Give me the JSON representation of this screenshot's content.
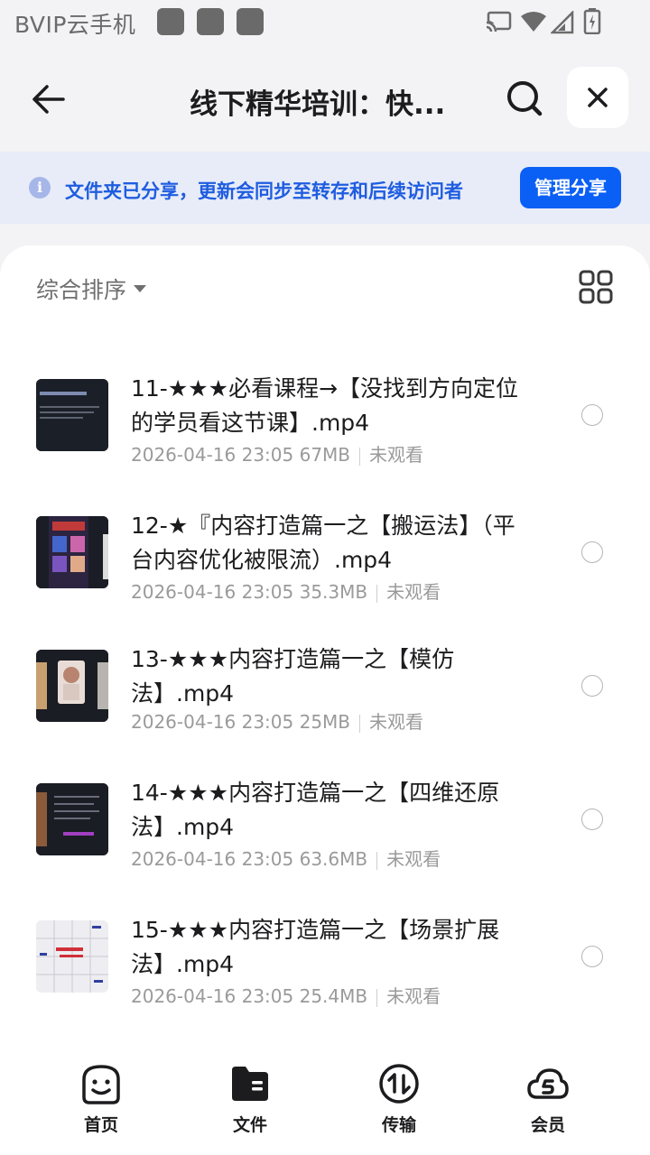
{
  "status_bar": {
    "carrier": "BVIP云手机",
    "icons": [
      "cast-icon",
      "wifi-icon",
      "signal-icon",
      "battery-icon"
    ]
  },
  "header": {
    "title": "线下精华培训：快...",
    "back_icon": "back-arrow-icon",
    "search_icon": "search-icon",
    "close_icon": "close-icon"
  },
  "banner": {
    "text": "文件夹已分享，更新会同步至转存和后续访问者",
    "button": "管理分享"
  },
  "toolbar": {
    "sort_label": "综合排序",
    "view_icon": "grid-view-icon"
  },
  "files": [
    {
      "name": "11-★★★必看课程→【没找到方向定位的学员看这节课】.mp4",
      "date": "2026-04-16 23:05",
      "size": "67MB",
      "status": "未观看"
    },
    {
      "name": "12-★『内容打造篇一之【搬运法】（平台内容优化被限流）.mp4",
      "date": "2026-04-16 23:05",
      "size": "35.3MB",
      "status": "未观看"
    },
    {
      "name": "13-★★★内容打造篇一之【模仿法】.mp4",
      "date": "2026-04-16 23:05",
      "size": "25MB",
      "status": "未观看"
    },
    {
      "name": "14-★★★内容打造篇一之【四维还原法】.mp4",
      "date": "2026-04-16 23:05",
      "size": "63.6MB",
      "status": "未观看"
    },
    {
      "name": "15-★★★内容打造篇一之【场景扩展法】.mp4",
      "date": "2026-04-16 23:05",
      "size": "25.4MB",
      "status": "未观看"
    }
  ],
  "nav": {
    "items": [
      {
        "label": "首页",
        "icon": "home-face-icon"
      },
      {
        "label": "文件",
        "icon": "folder-icon"
      },
      {
        "label": "传输",
        "icon": "transfer-icon"
      },
      {
        "label": "会员",
        "icon": "vip-cloud-icon"
      }
    ]
  },
  "colors": {
    "accent": "#0a5ff5",
    "banner_bg": "#e7ecf8",
    "banner_text": "#1f5ce0"
  }
}
